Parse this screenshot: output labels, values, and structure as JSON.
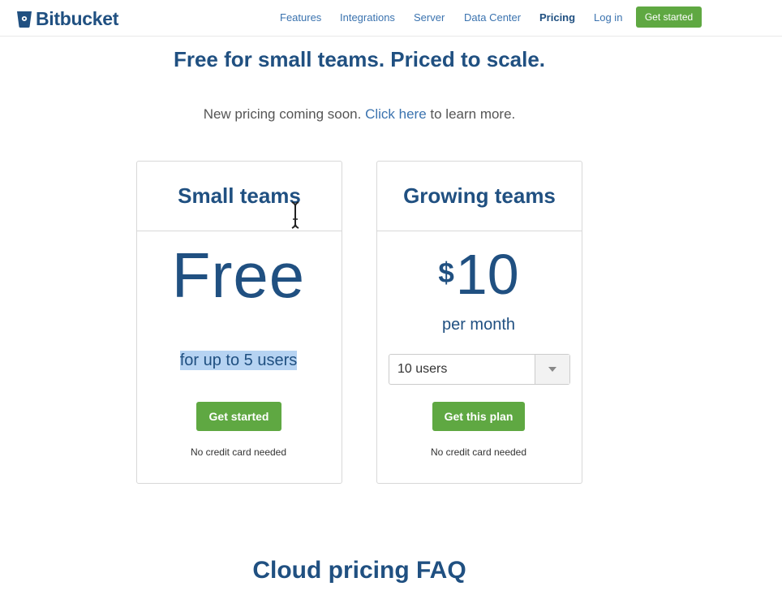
{
  "brand": {
    "name": "Bitbucket",
    "icon": "bitbucket-bucket-icon",
    "color": "#205081"
  },
  "nav": {
    "items": [
      "Features",
      "Integrations",
      "Server",
      "Data Center",
      "Pricing",
      "Log in"
    ],
    "active": "Pricing",
    "cta": "Get started"
  },
  "hero": {
    "headline": "Free for small teams. Priced to scale.",
    "notice_before": "New pricing coming soon. ",
    "notice_link": "Click here",
    "notice_after": " to learn more."
  },
  "plans": {
    "small": {
      "title": "Small teams",
      "price": "Free",
      "subtitle": "for up to 5 users",
      "button": "Get started",
      "note": "No credit card needed"
    },
    "growing": {
      "title": "Growing teams",
      "currency": "$",
      "amount": "10",
      "period": "per month",
      "users_selected": "10 users",
      "dropdown_icon": "triangle-down-icon",
      "button": "Get this plan",
      "note": "No credit card needed"
    }
  },
  "faq": {
    "title": "Cloud pricing FAQ"
  },
  "colors": {
    "accent_green": "#5fa842",
    "link_blue": "#3b73af",
    "text_navy": "#205081",
    "selection": "#b6d3f2"
  }
}
